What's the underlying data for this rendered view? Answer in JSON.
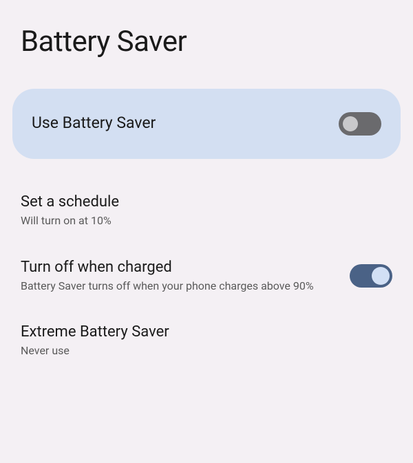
{
  "page": {
    "title": "Battery Saver"
  },
  "rows": {
    "use_battery_saver": {
      "title": "Use Battery Saver",
      "enabled": false
    },
    "set_schedule": {
      "title": "Set a schedule",
      "subtitle": "Will turn on at 10%"
    },
    "turn_off_charged": {
      "title": "Turn off when charged",
      "subtitle": "Battery Saver turns off when your phone charges above 90%",
      "enabled": true
    },
    "extreme": {
      "title": "Extreme Battery Saver",
      "subtitle": "Never use"
    }
  }
}
